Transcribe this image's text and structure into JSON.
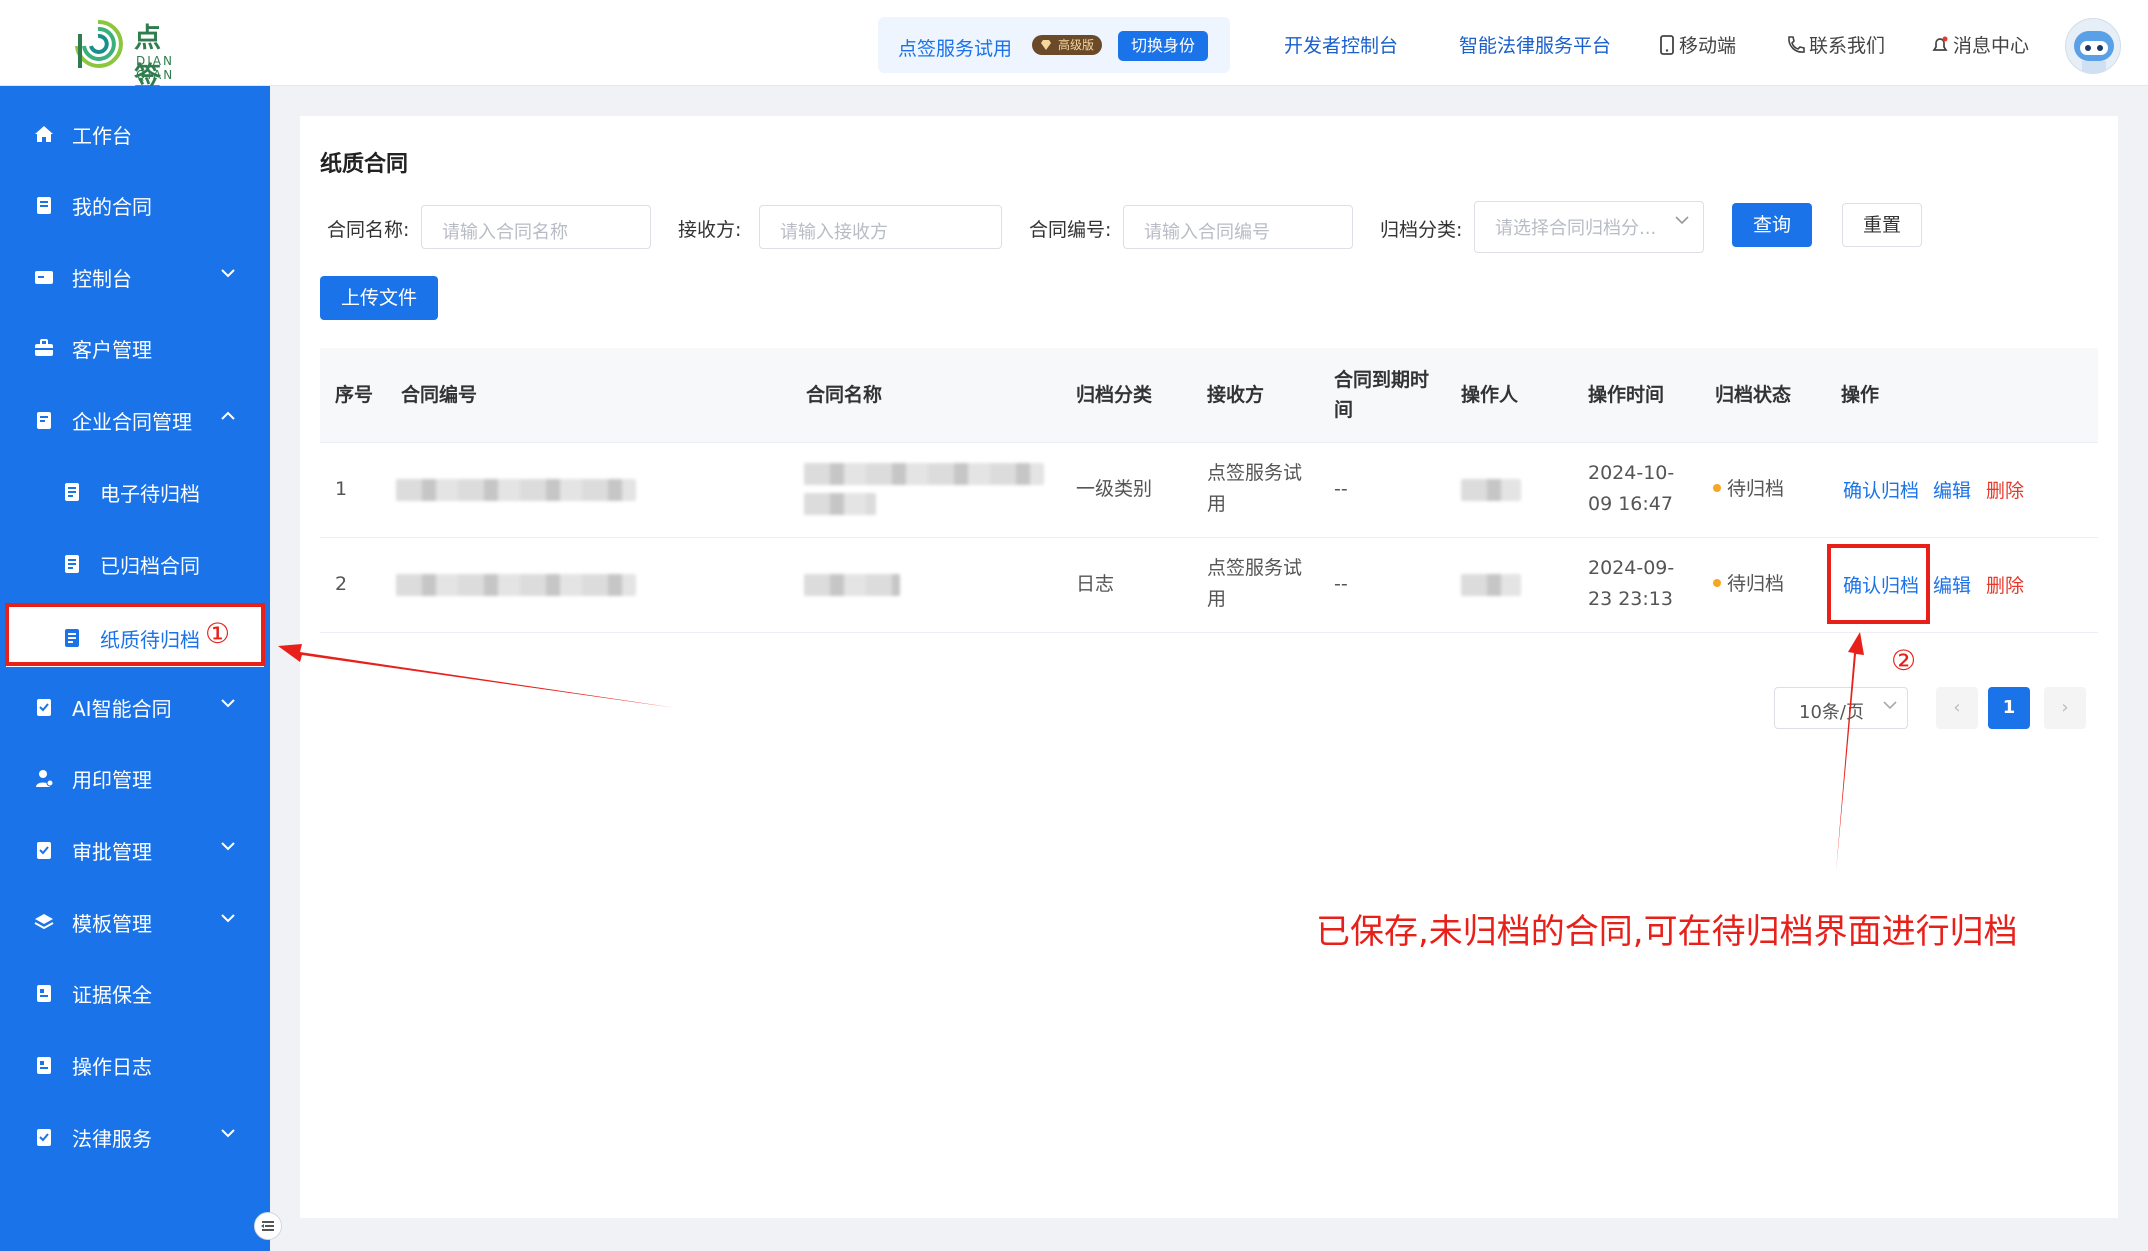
{
  "logo": {
    "cn": "点 签",
    "en": "DIAN QIAN"
  },
  "header": {
    "trial_name": "点签服务试用",
    "vip_badge": "高级版",
    "switch_identity": "切换身份",
    "nav": [
      "开发者控制台",
      "智能法律服务平台",
      "移动端",
      "联系我们",
      "消息中心"
    ]
  },
  "sidebar": {
    "items": [
      {
        "label": "工作台",
        "icon": "home-icon"
      },
      {
        "label": "我的合同",
        "icon": "contract-icon"
      },
      {
        "label": "控制台",
        "icon": "console-icon",
        "expand": "down"
      },
      {
        "label": "客户管理",
        "icon": "briefcase-icon"
      },
      {
        "label": "企业合同管理",
        "icon": "enterprise-contract-icon",
        "expand": "up"
      },
      {
        "label": "电子待归档",
        "icon": "doc-icon",
        "sub": true
      },
      {
        "label": "已归档合同",
        "icon": "doc-icon",
        "sub": true
      },
      {
        "label": "纸质待归档",
        "icon": "doc-icon",
        "sub": true,
        "active": true
      },
      {
        "label": "AI智能合同",
        "icon": "check-doc-icon",
        "expand": "down"
      },
      {
        "label": "用印管理",
        "icon": "seal-icon"
      },
      {
        "label": "审批管理",
        "icon": "check-doc-icon",
        "expand": "down"
      },
      {
        "label": "模板管理",
        "icon": "layers-icon",
        "expand": "down"
      },
      {
        "label": "证据保全",
        "icon": "evidence-icon"
      },
      {
        "label": "操作日志",
        "icon": "log-icon"
      },
      {
        "label": "法律服务",
        "icon": "check-doc-icon",
        "expand": "down"
      }
    ]
  },
  "main": {
    "title": "纸质合同",
    "filters": {
      "contract_name": {
        "label": "合同名称:",
        "placeholder": "请输入合同名称"
      },
      "receiver": {
        "label": "接收方:",
        "placeholder": "请输入接收方"
      },
      "contract_no": {
        "label": "合同编号:",
        "placeholder": "请输入合同编号"
      },
      "category": {
        "label": "归档分类:",
        "placeholder": "请选择合同归档分..."
      }
    },
    "buttons": {
      "query": "查询",
      "reset": "重置",
      "upload": "上传文件"
    },
    "table": {
      "headers": [
        "序号",
        "合同编号",
        "合同名称",
        "归档分类",
        "接收方",
        "合同到期时间",
        "操作人",
        "操作时间",
        "归档状态",
        "操作"
      ],
      "rows": [
        {
          "index": "1",
          "category": "一级类别",
          "receiver": "点签服务试用",
          "expire": "--",
          "time": "2024-10-09 16:47",
          "status": "待归档"
        },
        {
          "index": "2",
          "category": "日志",
          "receiver": "点签服务试用",
          "expire": "--",
          "time": "2024-09-23 23:13",
          "status": "待归档"
        }
      ],
      "actions": {
        "confirm": "确认归档",
        "edit": "编辑",
        "delete": "删除"
      }
    },
    "pagination": {
      "page_size": "10条/页",
      "current": "1",
      "prev": "‹",
      "next": "›"
    }
  },
  "annotations": {
    "marker1": "①",
    "marker2": "②",
    "note": "已保存,未归档的合同,可在待归档界面进行归档",
    "color": "#e8201a"
  },
  "colors": {
    "primary": "#1a73e8",
    "danger": "#e8382b",
    "pending": "#f5a623"
  }
}
